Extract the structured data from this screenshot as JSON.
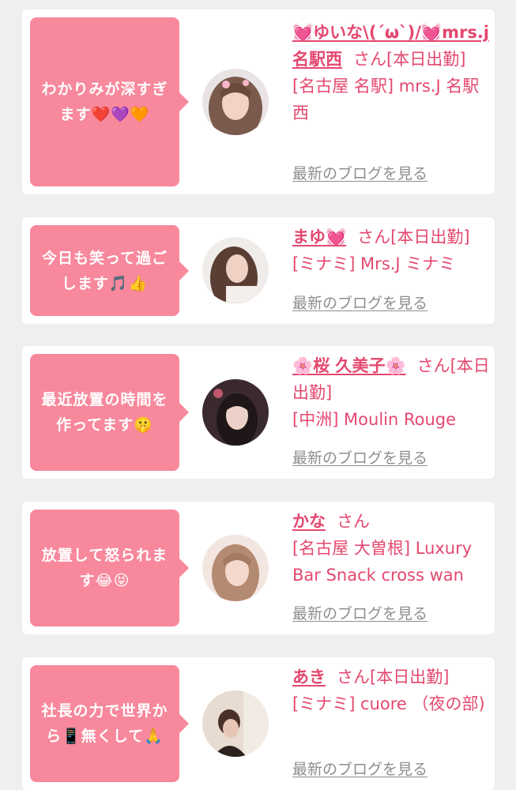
{
  "entries": [
    {
      "bubble": "わかりみが深すぎます❤️💜🧡",
      "name": "💓ゆいな\\(´ω`)/💓mrs.j名駅西",
      "san": "さん",
      "status": "[本日出勤]",
      "shop": "[名古屋 名駅] mrs.J 名駅西",
      "blog_link": "最新のブログを見る"
    },
    {
      "bubble": "今日も笑って過ごします🎵👍",
      "name": "まゆ💓",
      "san": "さん",
      "status": "[本日出勤]",
      "shop": "[ミナミ] Mrs.J ミナミ",
      "blog_link": "最新のブログを見る"
    },
    {
      "bubble": "最近放置の時間を作ってます🤫",
      "name": "🌸桜 久美子🌸",
      "san": "さん",
      "status": "[本日出勤]",
      "shop": "[中洲] Moulin Rouge",
      "blog_link": "最新のブログを見る"
    },
    {
      "bubble": "放置して怒られます😂😝",
      "name": "かな",
      "san": "さん",
      "status": "",
      "shop": "[名古屋 大曽根] Luxury Bar Snack cross wan",
      "blog_link": "最新のブログを見る"
    },
    {
      "bubble": "社長の力で世界から📱無くして🙏",
      "name": "あき",
      "san": "さん",
      "status": "[本日出勤]",
      "shop": "[ミナミ] cuore （夜の部)",
      "blog_link": "最新のブログを見る"
    }
  ]
}
